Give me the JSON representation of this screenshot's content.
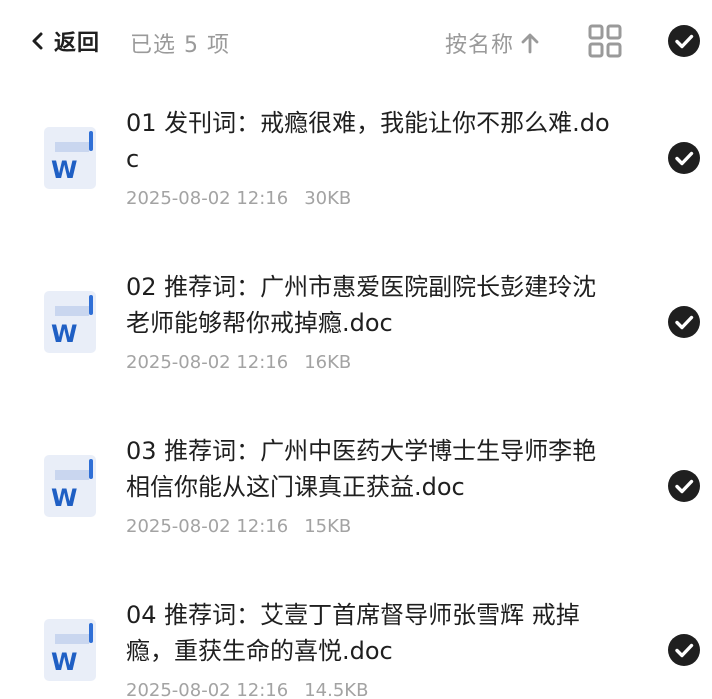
{
  "header": {
    "back_label": "返回",
    "selected_count": "已选 5 项",
    "sort_label": "按名称",
    "sort_icon": "arrow-up-icon",
    "view_icon": "grid-view-icon",
    "select_all_icon": "check-circle-icon"
  },
  "files": [
    {
      "name": "01 发刊词：戒瘾很难，我能让你不那么难.doc",
      "date": "2025-08-02 12:16",
      "size": "30KB",
      "icon": "word-doc-icon"
    },
    {
      "name": "02 推荐词：广州市惠爱医院副院长彭建玲沈老师能够帮你戒掉瘾.doc",
      "date": "2025-08-02 12:16",
      "size": "16KB",
      "icon": "word-doc-icon"
    },
    {
      "name": "03 推荐词：广州中医药大学博士生导师李艳 相信你能从这门课真正获益.doc",
      "date": "2025-08-02 12:16",
      "size": "15KB",
      "icon": "word-doc-icon"
    },
    {
      "name": "04 推荐词：艾壹丁首席督导师张雪辉 戒掉瘾，重获生命的喜悦.doc",
      "date": "2025-08-02 12:16",
      "size": "14.5KB",
      "icon": "word-doc-icon"
    }
  ],
  "colors": {
    "text_primary": "#1f1f1f",
    "text_secondary": "#9a9a9a",
    "check_fill": "#1f1f1f",
    "word_blue": "#1f5fc4",
    "word_bg": "#e9eef8"
  }
}
